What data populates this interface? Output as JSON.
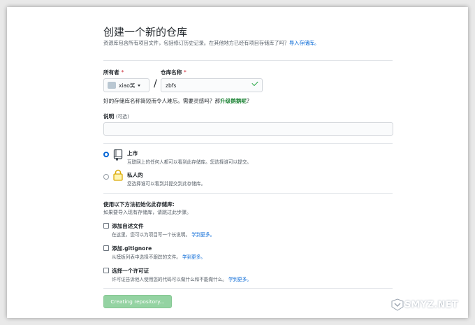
{
  "header": {
    "title": "创建一个新的仓库",
    "subtitle": "资源库包含所有项目文件，包括修订历史记录。在其他地方已经有项目存储库了吗？",
    "import_link": "导入存储库。"
  },
  "owner": {
    "label": "所有者",
    "required_mark": "*",
    "value": "xiao笑"
  },
  "repo_name": {
    "label": "仓库名称",
    "required_mark": "*",
    "value": "zbfs",
    "separator": "/"
  },
  "hint": {
    "text": "好的存储库名称简短而令人难忘。需要灵感吗？那",
    "suggestion": "升级鹅鹅呢",
    "end": "?"
  },
  "description": {
    "label": "说明",
    "optional": "(可选)",
    "value": ""
  },
  "visibility": {
    "public": {
      "title": "上市",
      "desc": "互联网上的任何人都可以看到此存储库。您选择谁可以提交。",
      "selected": true
    },
    "private": {
      "title": "私人的",
      "desc": "您选择谁可以看到并提交到此存储库。",
      "selected": false
    }
  },
  "init": {
    "title": "使用以下方法初始化此存储库:",
    "subtitle": "如果要导入现有存储库，请跳过此步骤。",
    "readme": {
      "title": "添加自述文件",
      "desc": "在这里，您可以为项目写一个长说明。",
      "learn": "学到更多。"
    },
    "gitignore": {
      "title": "添加.gitignore",
      "desc": "从模板列表中选择不跟踪的文件。",
      "learn": "学到更多。"
    },
    "license": {
      "title": "选择一个许可证",
      "desc": "许可证告诉他人使用您的代码可以做什么和不能做什么。",
      "learn": "学到更多。"
    }
  },
  "submit_label": "Creating repository...",
  "watermark": "SMYZ.NET",
  "colors": {
    "link": "#0366d6",
    "submit_bg": "#94d3a2",
    "success": "#28a745"
  }
}
